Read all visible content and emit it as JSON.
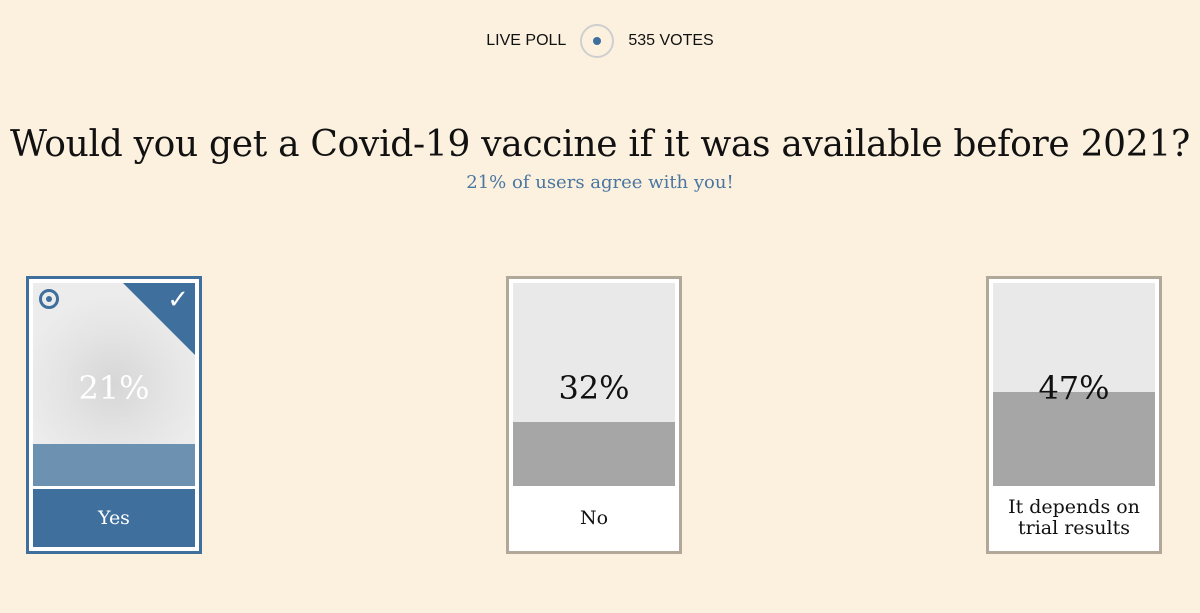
{
  "header": {
    "live_label": "LIVE POLL",
    "votes_label": "535 VOTES"
  },
  "question": "Would you get a Covid-19 vaccine if it was available before 2021?",
  "subtitle": "21% of users agree with you!",
  "options": [
    {
      "label": "Yes",
      "percent_text": "21%",
      "percent": 21,
      "selected": true
    },
    {
      "label": "No",
      "percent_text": "32%",
      "percent": 32,
      "selected": false
    },
    {
      "label": "It depends on trial results",
      "percent_text": "47%",
      "percent": 47,
      "selected": false
    }
  ],
  "colors": {
    "background": "#fcf1df",
    "accent": "#3f6f9c",
    "fill": "#a6a6a6",
    "selected_fill": "#6d91b1",
    "subtitle": "#4a76a0"
  },
  "icons": {
    "live": "live-dot-icon",
    "selected_radio": "radio-selected-icon",
    "check": "checkmark-icon"
  }
}
